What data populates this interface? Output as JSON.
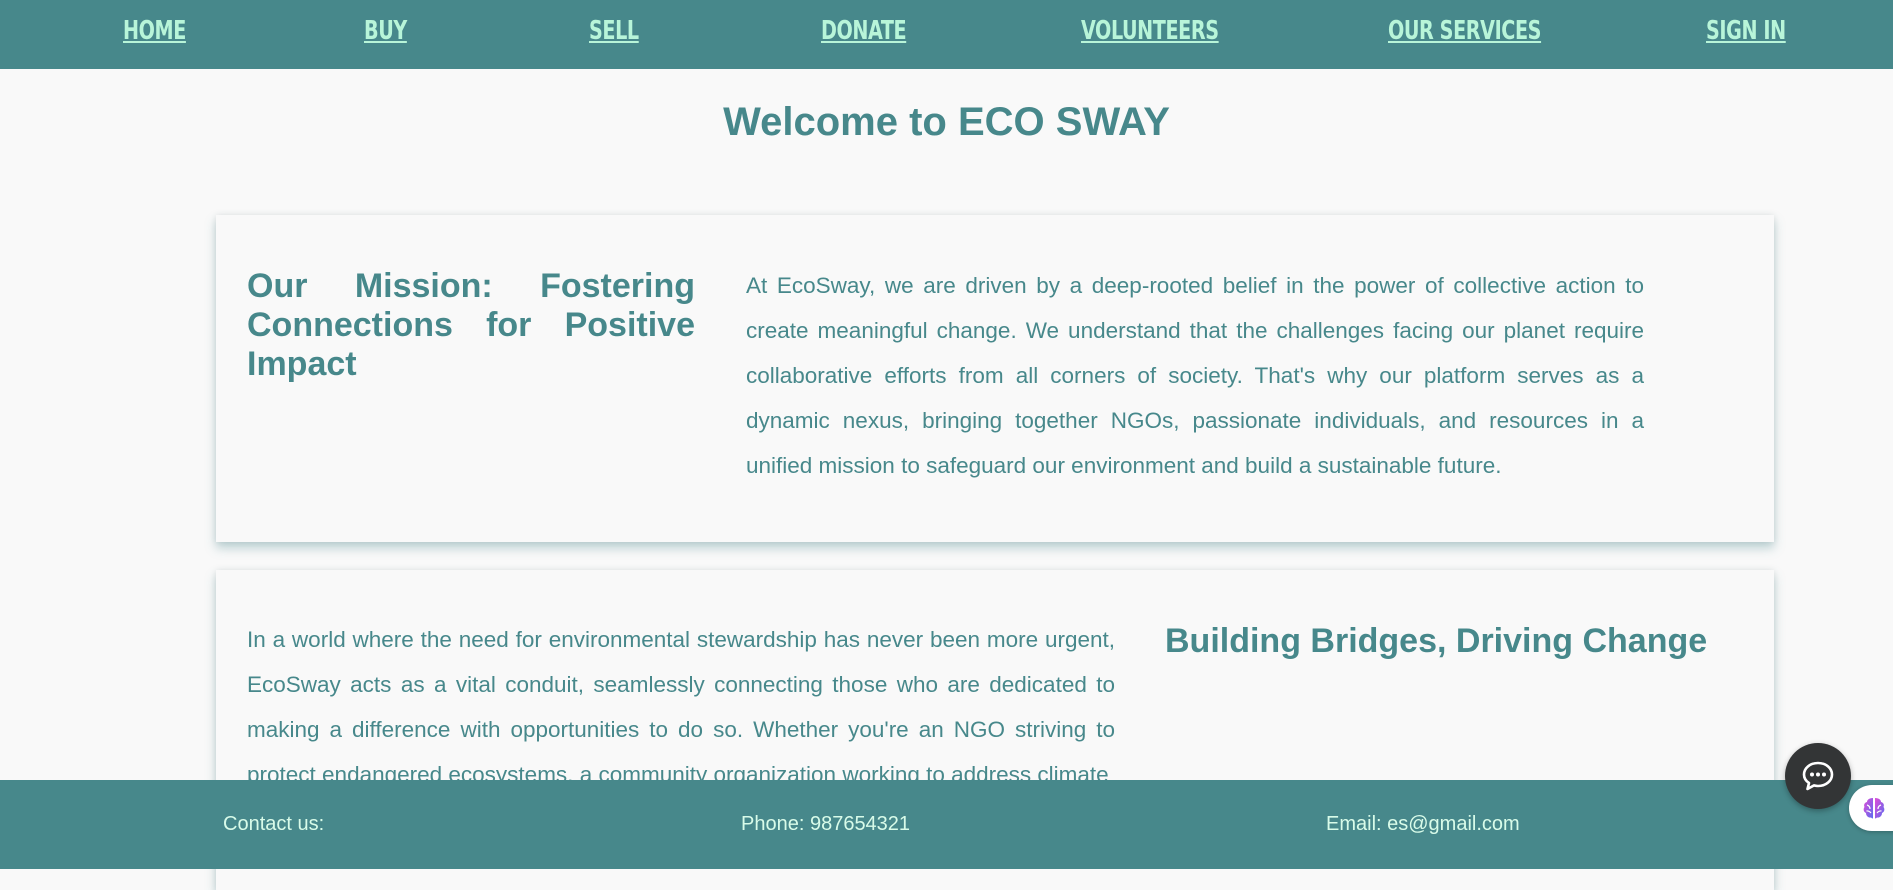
{
  "nav": {
    "items": [
      {
        "label": "HOME"
      },
      {
        "label": "BUY"
      },
      {
        "label": "SELL"
      },
      {
        "label": "DONATE"
      },
      {
        "label": "VOLUNTEERS"
      },
      {
        "label": "OUR SERVICES"
      },
      {
        "label": "SIGN IN"
      }
    ]
  },
  "page": {
    "title": "Welcome to ECO SWAY"
  },
  "mission": {
    "heading": "Our Mission: Fostering Connections for Positive Impact",
    "text": "At EcoSway, we are driven by a deep-rooted belief in the power of collective action to create meaningful change. We understand that the challenges facing our planet require collaborative efforts from all corners of society. That's why our platform serves as a dynamic nexus, bringing together NGOs, passionate individuals, and resources in a unified mission to safeguard our environment and build a sustainable future."
  },
  "bridges": {
    "heading": "Building Bridges, Driving Change",
    "text": "In a world where the need for environmental stewardship has never been more urgent, EcoSway acts as a vital conduit, seamlessly connecting those who are dedicated to making a difference with opportunities to do so. Whether you're an NGO striving to protect endangered ecosystems, a community organization working to address climate"
  },
  "footer": {
    "contact": "Contact us:",
    "phone": "Phone: 987654321",
    "email": "Email: es@gmail.com"
  },
  "icons": {
    "chat": "chat-bubble-icon",
    "extension": "brain-icon"
  },
  "colors": {
    "primary": "#47888b",
    "nav_text": "#b8f5d9",
    "background": "#f9f9f9",
    "chat_button": "#333536"
  }
}
